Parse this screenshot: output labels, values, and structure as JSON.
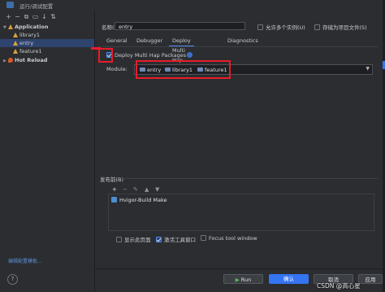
{
  "window": {
    "title": "运行/调试配置"
  },
  "sidebar": {
    "toolbar": [
      "+",
      "−",
      "⧉",
      "▭",
      "↓",
      "⇅"
    ],
    "tree": [
      {
        "label": "Application",
        "level": 0,
        "expanded": true,
        "bold": true
      },
      {
        "label": "library1",
        "level": 1
      },
      {
        "label": "entry",
        "level": 1,
        "selected": true
      },
      {
        "label": "feature1",
        "level": 1
      },
      {
        "label": "Hot Reload",
        "level": 0,
        "expanded": false,
        "bold": true
      }
    ],
    "edit_templates": "编辑配置模板...",
    "help": "?"
  },
  "form": {
    "name_label": "名称(N):",
    "name_value": "entry",
    "allow_parallel": "允许多个实例(U)",
    "store_as_project_file": "存储为项目文件(S)",
    "tabs": [
      "General",
      "Debugger",
      "Deploy Multi Hap",
      "Diagnostics"
    ],
    "active_tab": 2,
    "deploy_checkbox": "Deploy Multi Hap Packages",
    "deploy_checked": true,
    "module_label": "Module:",
    "modules": [
      "entry",
      "library1",
      "feature1"
    ]
  },
  "before_launch": {
    "title": "发布前(B)",
    "toolbar": [
      "+",
      "−",
      "✎",
      "▲",
      "▼"
    ],
    "items": [
      "Hvigor-Build Make"
    ]
  },
  "options": {
    "show_page": "显示此页面",
    "activate_tool_window": "激活工具窗口",
    "focus_tool_window": "Focus tool window",
    "activate_checked": true
  },
  "footer": {
    "run": "Run",
    "ok": "确认",
    "cancel": "取消",
    "apply": "应用"
  },
  "watermark": "CSDN @高心星",
  "colors": {
    "accent": "#3574f0",
    "highlight": "#e81c2a",
    "selection": "#2e436e"
  }
}
